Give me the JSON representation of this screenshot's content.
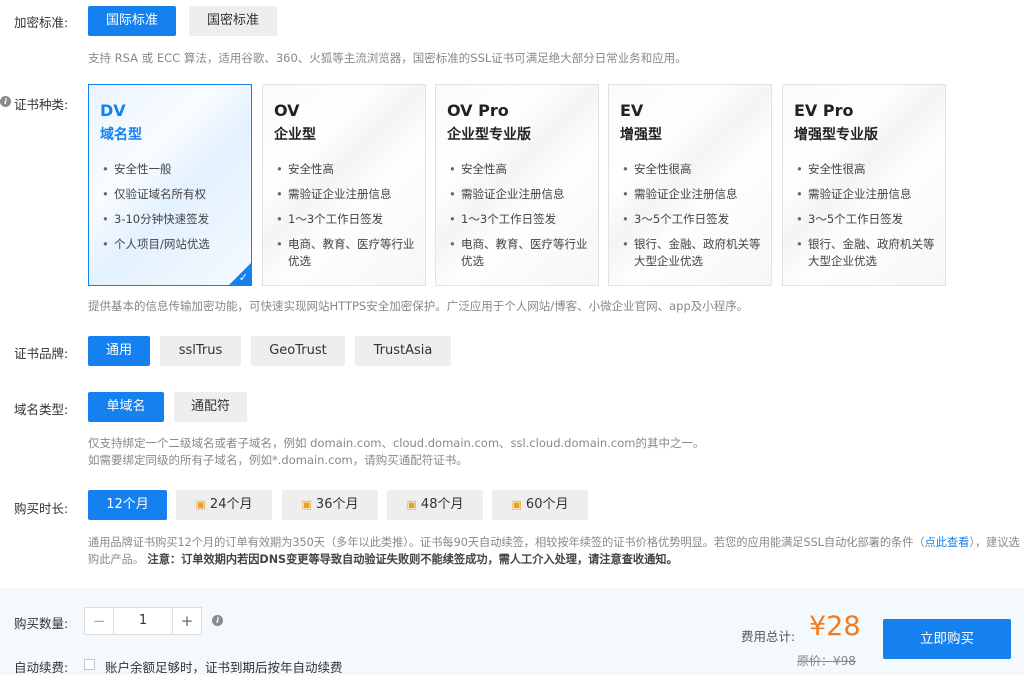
{
  "encryption": {
    "label": "加密标准:",
    "options": [
      "国际标准",
      "国密标准"
    ],
    "hint": "支持 RSA 或 ECC 算法，适用谷歌、360、火狐等主流浏览器，国密标准的SSL证书可满足绝大部分日常业务和应用。"
  },
  "cert_type": {
    "label": "证书种类:",
    "cards": [
      {
        "title": "DV",
        "subtitle": "域名型",
        "features": [
          "安全性一般",
          "仅验证域名所有权",
          "3-10分钟快速签发",
          "个人项目/网站优选"
        ]
      },
      {
        "title": "OV",
        "subtitle": "企业型",
        "features": [
          "安全性高",
          "需验证企业注册信息",
          "1～3个工作日签发",
          "电商、教育、医疗等行业优选"
        ]
      },
      {
        "title": "OV Pro",
        "subtitle": "企业型专业版",
        "features": [
          "安全性高",
          "需验证企业注册信息",
          "1～3个工作日签发",
          "电商、教育、医疗等行业优选"
        ]
      },
      {
        "title": "EV",
        "subtitle": "增强型",
        "features": [
          "安全性很高",
          "需验证企业注册信息",
          "3～5个工作日签发",
          "银行、金融、政府机关等大型企业优选"
        ]
      },
      {
        "title": "EV Pro",
        "subtitle": "增强型专业版",
        "features": [
          "安全性很高",
          "需验证企业注册信息",
          "3～5个工作日签发",
          "银行、金融、政府机关等大型企业优选"
        ]
      }
    ],
    "hint": "提供基本的信息传输加密功能，可快速实现网站HTTPS安全加密保护。广泛应用于个人网站/博客、小微企业官网、app及小程序。"
  },
  "brand": {
    "label": "证书品牌:",
    "options": [
      "通用",
      "sslTrus",
      "GeoTrust",
      "TrustAsia"
    ]
  },
  "domain_type": {
    "label": "域名类型:",
    "options": [
      "单域名",
      "通配符"
    ],
    "hint1": "仅支持绑定一个二级域名或者子域名，例如 domain.com、cloud.domain.com、ssl.cloud.domain.com的其中之一。",
    "hint2": "如需要绑定同级的所有子域名，例如*.domain.com，请购买通配符证书。"
  },
  "duration": {
    "label": "购买时长:",
    "options": [
      "12个月",
      "24个月",
      "36个月",
      "48个月",
      "60个月"
    ],
    "hint_a": "通用品牌证书购买12个月的订单有效期为350天（多年以此类推）。证书每90天自动续签，相较按年续签的证书价格优势明显。若您的应用能满足SSL自动化部署的条件（",
    "hint_link": "点此查看",
    "hint_b": "），建议选",
    "hint_c": "购此产品。",
    "hint_note_label": "注意：",
    "hint_note": "订单效期内若因DNS变更等导致自动验证失败则不能续签成功，需人工介入处理，请注意查收通知。"
  },
  "quantity": {
    "label": "购买数量:",
    "value": "1",
    "minus": "−",
    "plus": "+"
  },
  "auto_renew": {
    "label": "自动续费:",
    "text": "账户余额足够时，证书到期后按年自动续费"
  },
  "price": {
    "total_label": "费用总计:",
    "total": "¥28",
    "original": "原价：¥98"
  },
  "buy_button": "立即购买",
  "colors": {
    "accent": "#1481ee",
    "price": "#f57a18"
  }
}
